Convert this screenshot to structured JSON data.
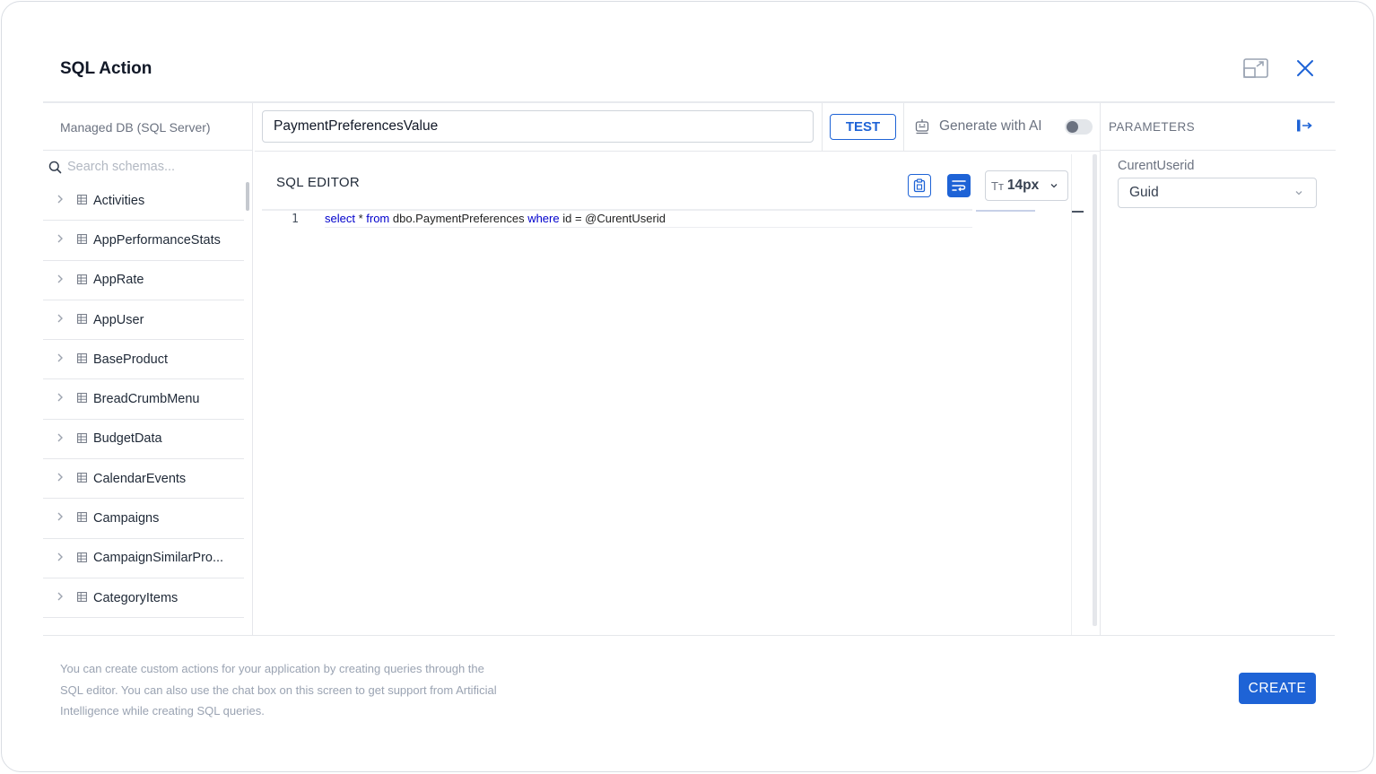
{
  "modal": {
    "title": "SQL Action"
  },
  "schemas": {
    "db_label": "Managed DB (SQL Server)",
    "search_placeholder": "Search schemas...",
    "items": [
      {
        "label": "Activities"
      },
      {
        "label": "AppPerformanceStats"
      },
      {
        "label": "AppRate"
      },
      {
        "label": "AppUser"
      },
      {
        "label": "BaseProduct"
      },
      {
        "label": "BreadCrumbMenu"
      },
      {
        "label": "BudgetData"
      },
      {
        "label": "CalendarEvents"
      },
      {
        "label": "Campaigns"
      },
      {
        "label": "CampaignSimilarPro..."
      },
      {
        "label": "CategoryItems"
      }
    ]
  },
  "toolbar": {
    "action_name": "PaymentPreferencesValue",
    "test_label": "TEST",
    "ai_label": "Generate with AI",
    "ai_enabled": false
  },
  "editor": {
    "title": "SQL EDITOR",
    "font_size_icon": "Tт",
    "font_size": "14px",
    "line_number": "1",
    "code": {
      "kw_select": "select",
      "part_star": " * ",
      "kw_from": "from",
      "part_table": " dbo.PaymentPreferences ",
      "kw_where": "where",
      "part_cond": " id = @CurentUserid"
    }
  },
  "parameters": {
    "title": "PARAMETERS",
    "items": [
      {
        "name": "CurentUserid",
        "type": "Guid"
      }
    ]
  },
  "footer": {
    "help_text": "You can create custom actions for your application by creating queries through the SQL editor. You can also use the chat box on this screen to get support from Artificial Intelligence while creating SQL queries.",
    "create_label": "CREATE"
  },
  "colors": {
    "accent": "#1e63d6",
    "keyword": "#0000cc",
    "muted": "#6b7280"
  }
}
